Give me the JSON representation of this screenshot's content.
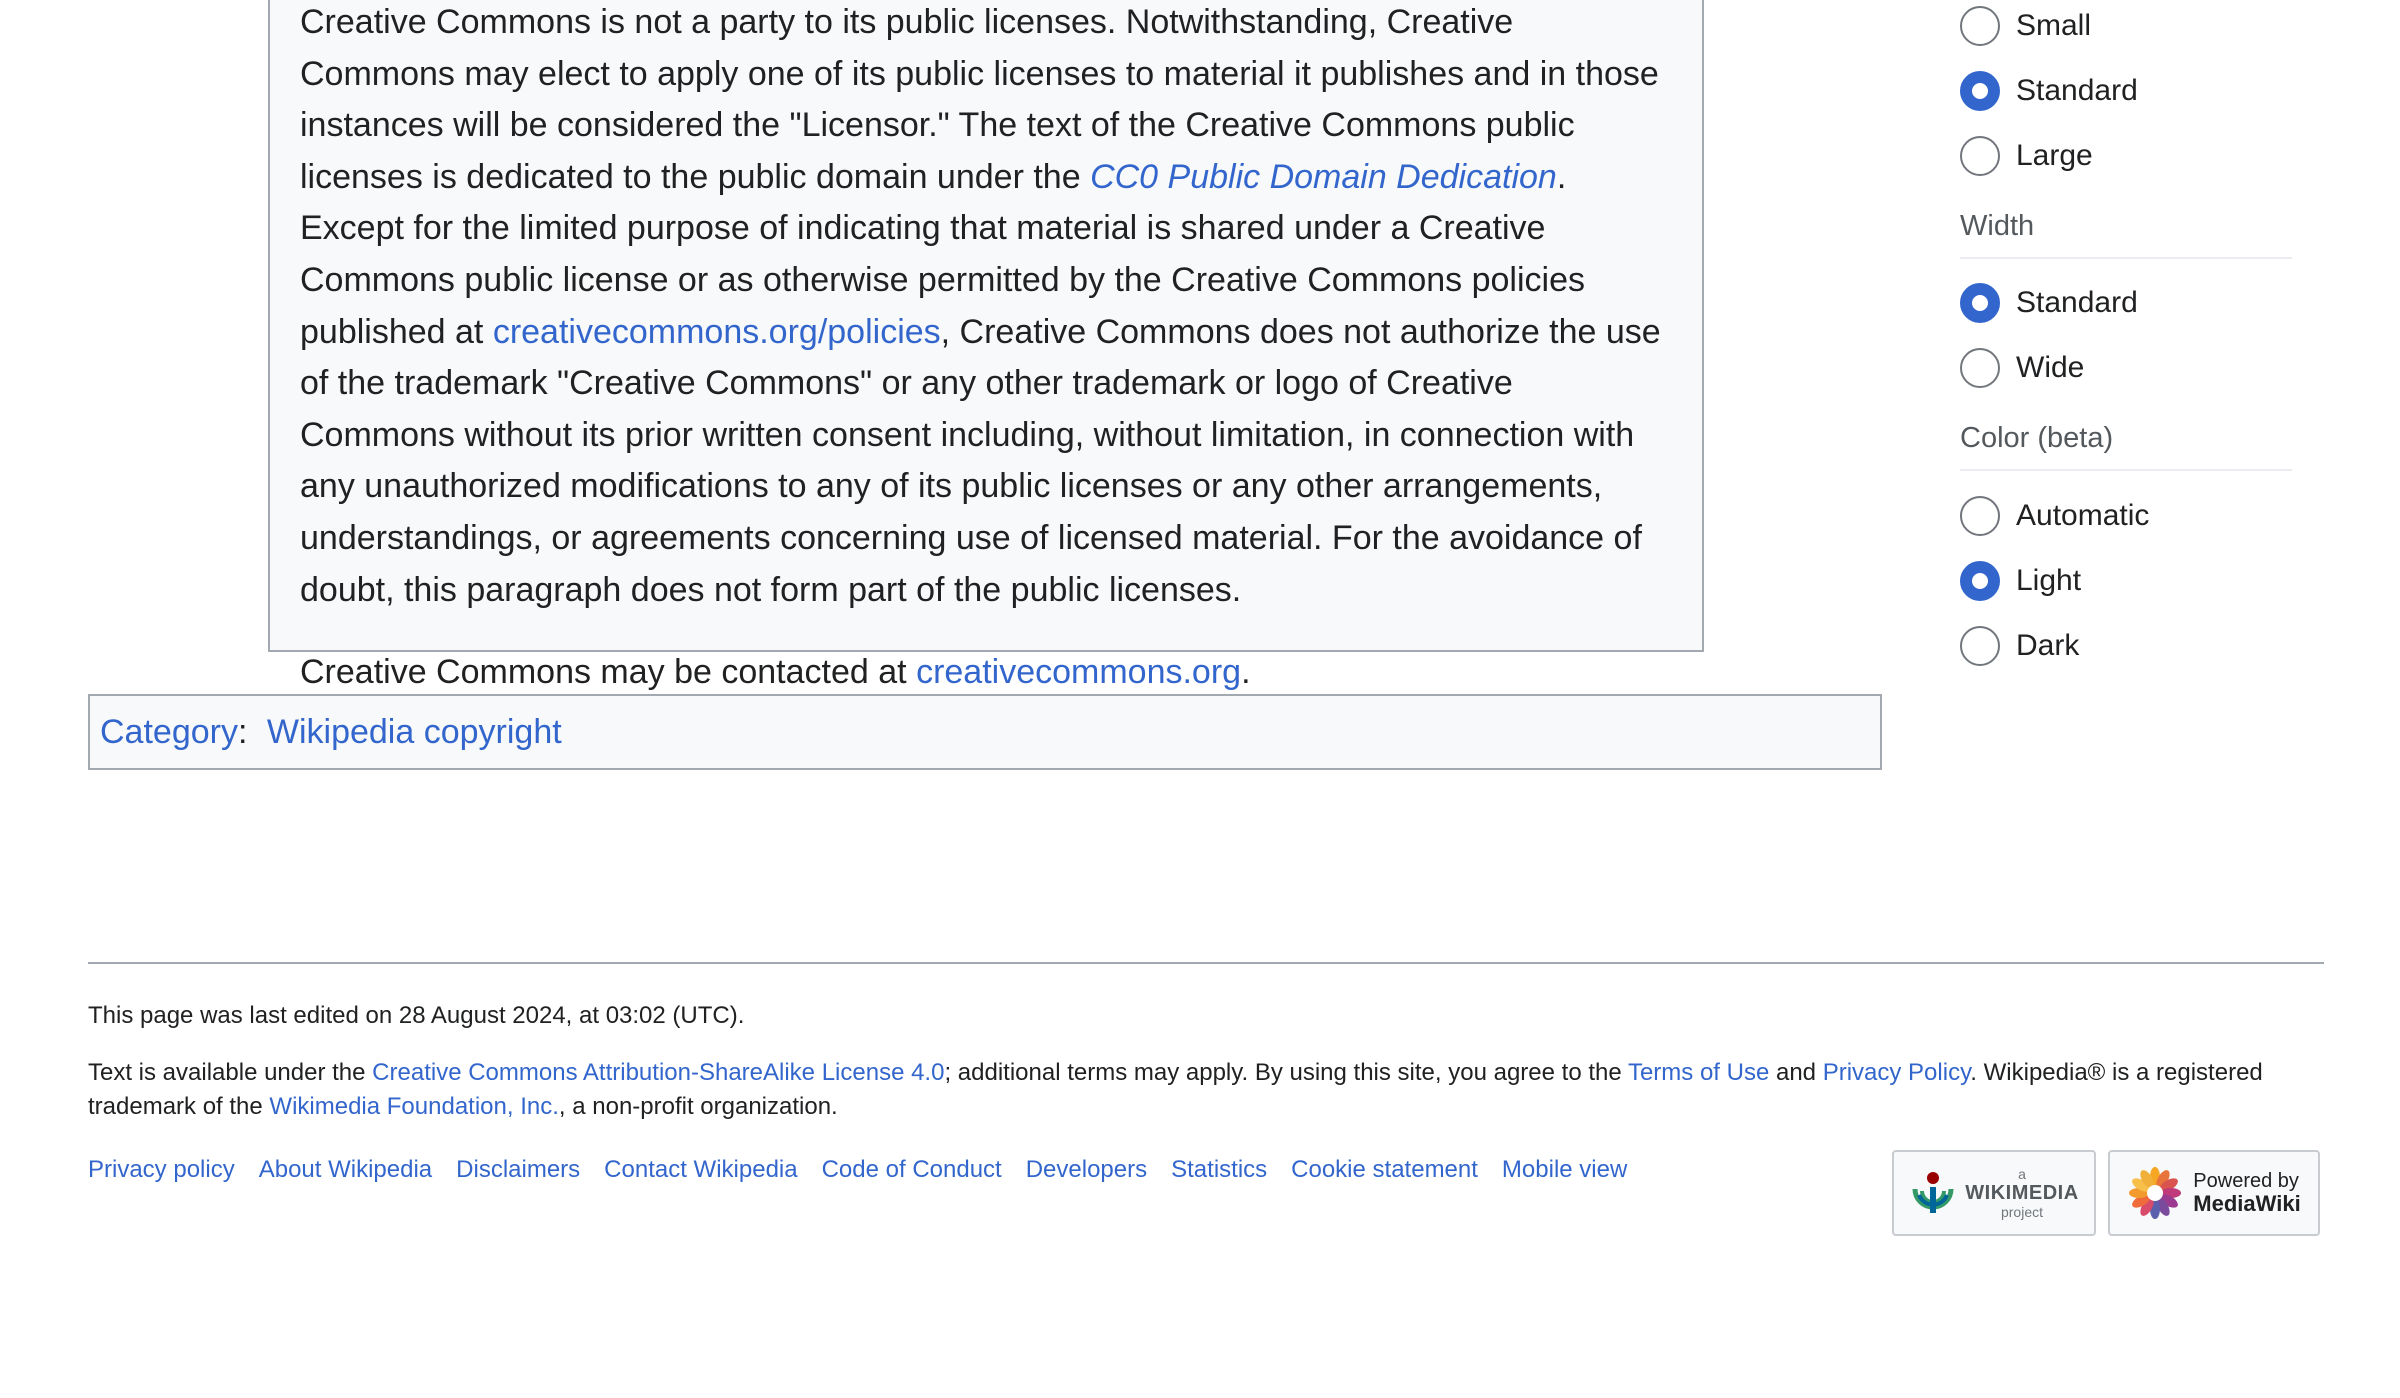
{
  "notice": {
    "p1_part1": "Creative Commons is not a party to its public licenses. Notwithstanding, Creative Commons may elect to apply one of its public licenses to material it publishes and in those instances will be considered the \"Licensor.\" The text of the Creative Commons public licenses is dedicated to the public domain under the ",
    "cc0_link": "CC0 Public Domain Dedication",
    "p1_part2": ". Except for the limited purpose of indicating that material is shared under a Creative Commons public license or as otherwise permitted by the Creative Commons policies published at ",
    "policies_link": "creativecommons.org/policies",
    "p1_part3": ", Creative Commons does not authorize the use of the trademark \"Creative Commons\" or any other trademark or logo of Creative Commons without its prior written consent including, without limitation, in connection with any unauthorized modifications to any of its public licenses or any other arrangements, understandings, or agreements concerning use of licensed material. For the avoidance of doubt, this paragraph does not form part of the public licenses.",
    "p2_part1": "Creative Commons may be contacted at ",
    "contact_link": "creativecommons.org",
    "p2_part2": "."
  },
  "categories": {
    "label": "Category",
    "separator": ":",
    "items": [
      "Wikipedia copyright"
    ]
  },
  "appearance": {
    "text_options": [
      {
        "label": "Small",
        "checked": false
      },
      {
        "label": "Standard",
        "checked": true
      },
      {
        "label": "Large",
        "checked": false
      }
    ],
    "width_heading": "Width",
    "width_options": [
      {
        "label": "Standard",
        "checked": true
      },
      {
        "label": "Wide",
        "checked": false
      }
    ],
    "color_heading": "Color (beta)",
    "color_options": [
      {
        "label": "Automatic",
        "checked": false
      },
      {
        "label": "Light",
        "checked": true
      },
      {
        "label": "Dark",
        "checked": false
      }
    ]
  },
  "footer": {
    "last_modified": "This page was last edited on 28 August 2024, at 03:02 (UTC).",
    "license_part1": "Text is available under the ",
    "license_link": "Creative Commons Attribution-ShareAlike License 4.0",
    "license_part2": "; additional terms may apply. By using this site, you agree to the ",
    "terms_link": "Terms of Use",
    "license_part3": " and ",
    "privacy_link": "Privacy Policy",
    "license_part4": ". Wikipedia® is a registered trademark of the ",
    "foundation_link": "Wikimedia Foundation, Inc.",
    "license_part5": ", a non-profit organization.",
    "places": [
      "Privacy policy",
      "About Wikipedia",
      "Disclaimers",
      "Contact Wikipedia",
      "Code of Conduct",
      "Developers",
      "Statistics",
      "Cookie statement",
      "Mobile view"
    ],
    "wikimedia_badge": {
      "small_top": "a",
      "big": "WIKIMEDIA",
      "small_bottom": "project"
    },
    "mediawiki_badge": {
      "line1": "Powered by",
      "line2": "MediaWiki"
    }
  },
  "colors": {
    "link": "#3366cc",
    "text": "#202122",
    "box_bg": "#f8f9fa",
    "border": "#a2a9b1",
    "radio_checked": "#3366cc"
  }
}
